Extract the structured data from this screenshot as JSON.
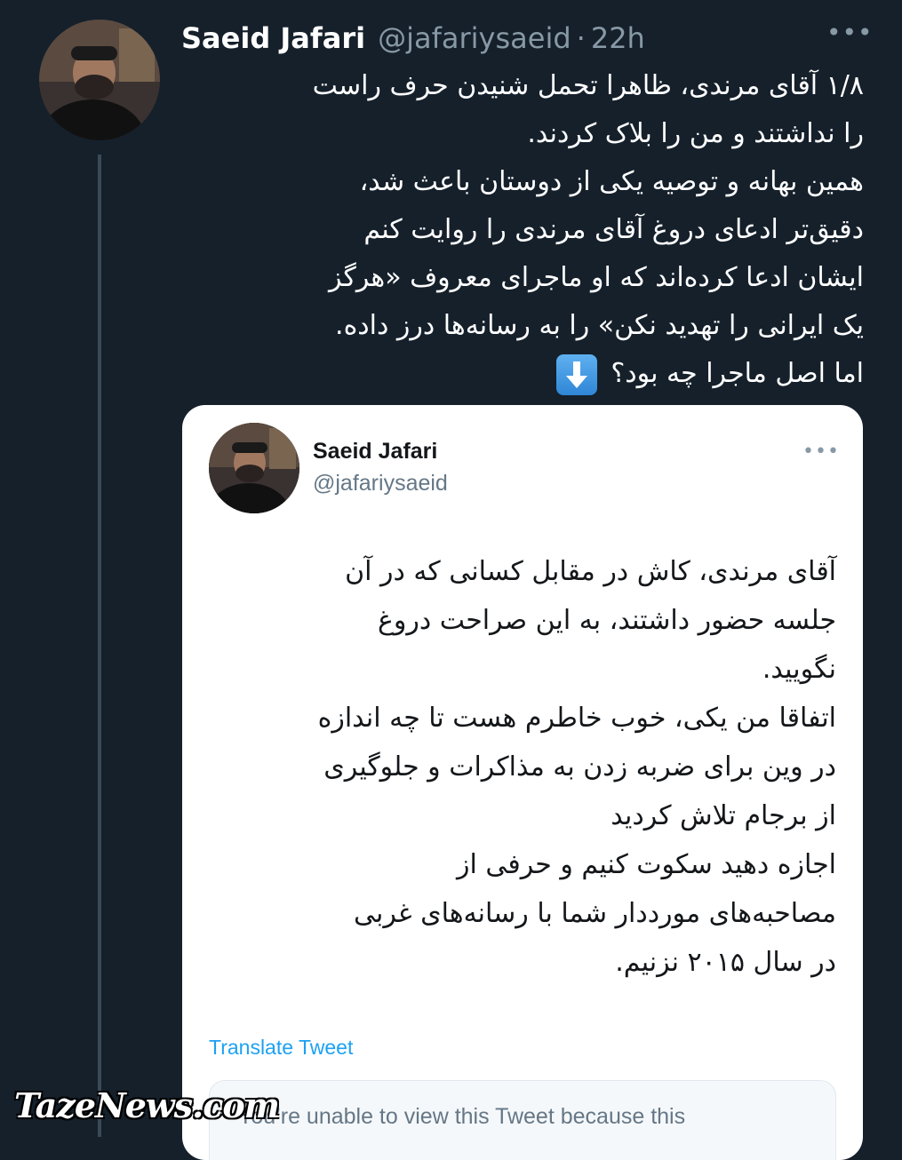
{
  "tweet": {
    "author_name": "Saeid Jafari",
    "author_handle": "@jafariysaeid",
    "separator": "·",
    "time": "22h",
    "more": "•••",
    "text_lines": [
      "۱/۸ آقای مرندی، ظاهرا تحمل شنیدن حرف راست",
      "را نداشتند و من را بلاک کردند.",
      "همین بهانه و توصیه یکی از دوستان باعث شد،",
      "دقیق‌تر ادعای دروغ آقای مرندی را روایت کنم",
      "ایشان ادعا کرده‌اند که او ماجرای معروف «هرگز",
      "یک ایرانی را تهدید نکن» را به رسانه‌ها درز داده.",
      "اما اصل ماجرا چه بود؟"
    ],
    "emoji": "down-arrow-emoji"
  },
  "quoted": {
    "author_name": "Saeid Jafari",
    "author_handle": "@jafariysaeid",
    "more": "•••",
    "text_lines": [
      "آقای مرندی، کاش در مقابل کسانی که در آن",
      "جلسه حضور داشتند، به این صراحت دروغ",
      "نگویید.",
      "اتفاقا من یکی، خوب خاطرم هست تا چه اندازه",
      "در وین برای ضربه زدن به مذاکرات و جلوگیری",
      "از برجام تلاش کردید",
      "اجازه دهید سکوت کنیم و حرفی از",
      "مصاحبه‌های مورددار شما با رسانه‌های غربی",
      "در سال ۲۰۱۵ نزنیم."
    ],
    "translate": "Translate Tweet",
    "unavailable_notice": "You’re unable to view this Tweet because this"
  },
  "watermark": "TazeNews.com",
  "colors": {
    "background": "#15202b",
    "link": "#1da1f2",
    "secondary_text": "#8899a6"
  }
}
